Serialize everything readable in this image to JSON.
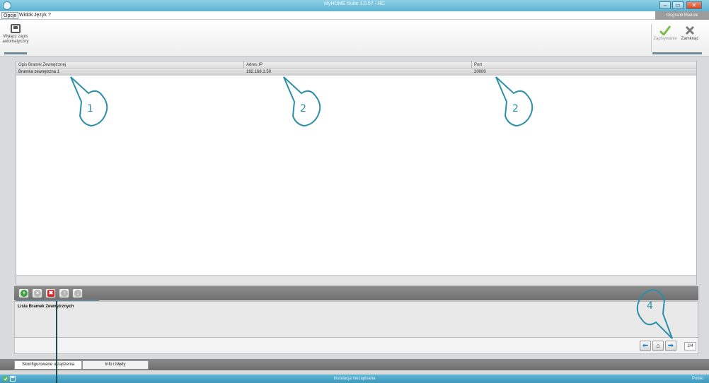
{
  "window": {
    "title": "MyHOME Suite 1.0.57 - RC",
    "controls": {
      "minimize": "‒",
      "maximize": "▭",
      "close": "✕"
    }
  },
  "menu": {
    "items": [
      "Opcje",
      "Widok",
      "Język",
      "?"
    ],
    "status_pill": "Disgranti Manoni"
  },
  "ribbon": {
    "left_button_label": "Wyłącz zapis automatyczny",
    "save_label": "Zapisywanie",
    "close_label": "Zamknąć"
  },
  "grid": {
    "columns": [
      "Opis Bramki Zewnętrznej",
      "Adres IP",
      "Port"
    ],
    "rows": [
      [
        "Bramka zewnętrzna 1",
        "192.168.1.50",
        "20000"
      ]
    ]
  },
  "toolbar": {
    "icons": [
      "add-icon",
      "remove-icon",
      "delete-icon",
      "move-up-icon",
      "move-down-icon"
    ]
  },
  "description": {
    "title": "Lista Bramek Zewnętrznych"
  },
  "navigation": {
    "page_indicator": "2/4"
  },
  "tabs": [
    "Skonfigurowane urządzenia",
    "Info i błędy"
  ],
  "status": {
    "center_text": "Instalacja niezapisana",
    "language": "Polski"
  },
  "annotations": [
    "1",
    "2",
    "2",
    "4"
  ],
  "colors": {
    "accent": "#3e98bd",
    "annotation": "#2d8fa8",
    "add_green": "#3aa23a",
    "delete_red": "#d9262b"
  }
}
